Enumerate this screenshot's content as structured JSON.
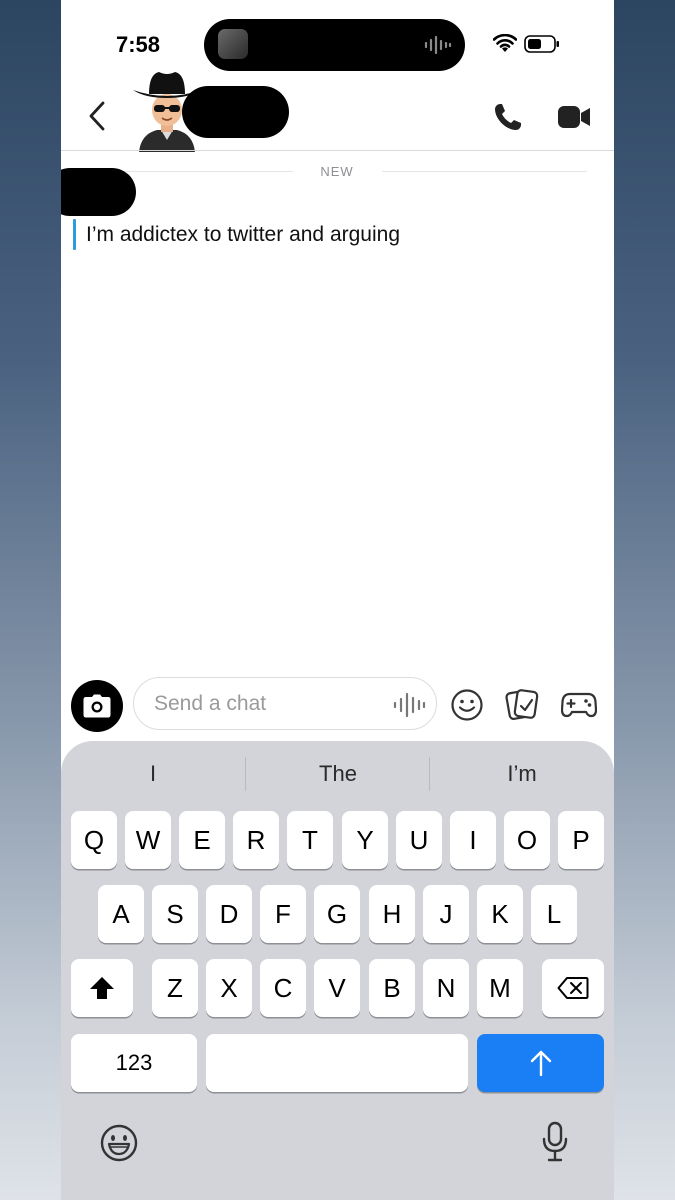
{
  "status_bar": {
    "time": "7:58"
  },
  "header": {
    "back_icon": "chevron-left-icon",
    "call_icon": "phone-icon",
    "video_icon": "video-camera-icon"
  },
  "chat": {
    "divider_label": "NEW",
    "messages": [
      {
        "text": "I’m addictex to twitter and arguing",
        "accent": "#2d9cdb"
      }
    ]
  },
  "compose": {
    "placeholder": "Send a chat",
    "camera_icon": "camera-icon",
    "voice_icon": "voice-waveform-icon",
    "emoji_icon": "smiley-icon",
    "memories_icon": "memories-icon",
    "games_icon": "game-controller-icon"
  },
  "keyboard": {
    "suggestions": [
      "I",
      "The",
      "I’m"
    ],
    "row1": [
      "Q",
      "W",
      "E",
      "R",
      "T",
      "Y",
      "U",
      "I",
      "O",
      "P"
    ],
    "row2": [
      "A",
      "S",
      "D",
      "F",
      "G",
      "H",
      "J",
      "K",
      "L"
    ],
    "row3": [
      "Z",
      "X",
      "C",
      "V",
      "B",
      "N",
      "M"
    ],
    "numbers_label": "123",
    "shift_icon": "shift-arrow-icon",
    "delete_icon": "backspace-icon",
    "return_icon": "send-arrow-icon",
    "return_color": "#1a7ff5",
    "emoji_key_icon": "emoji-icon",
    "mic_icon": "microphone-icon"
  }
}
